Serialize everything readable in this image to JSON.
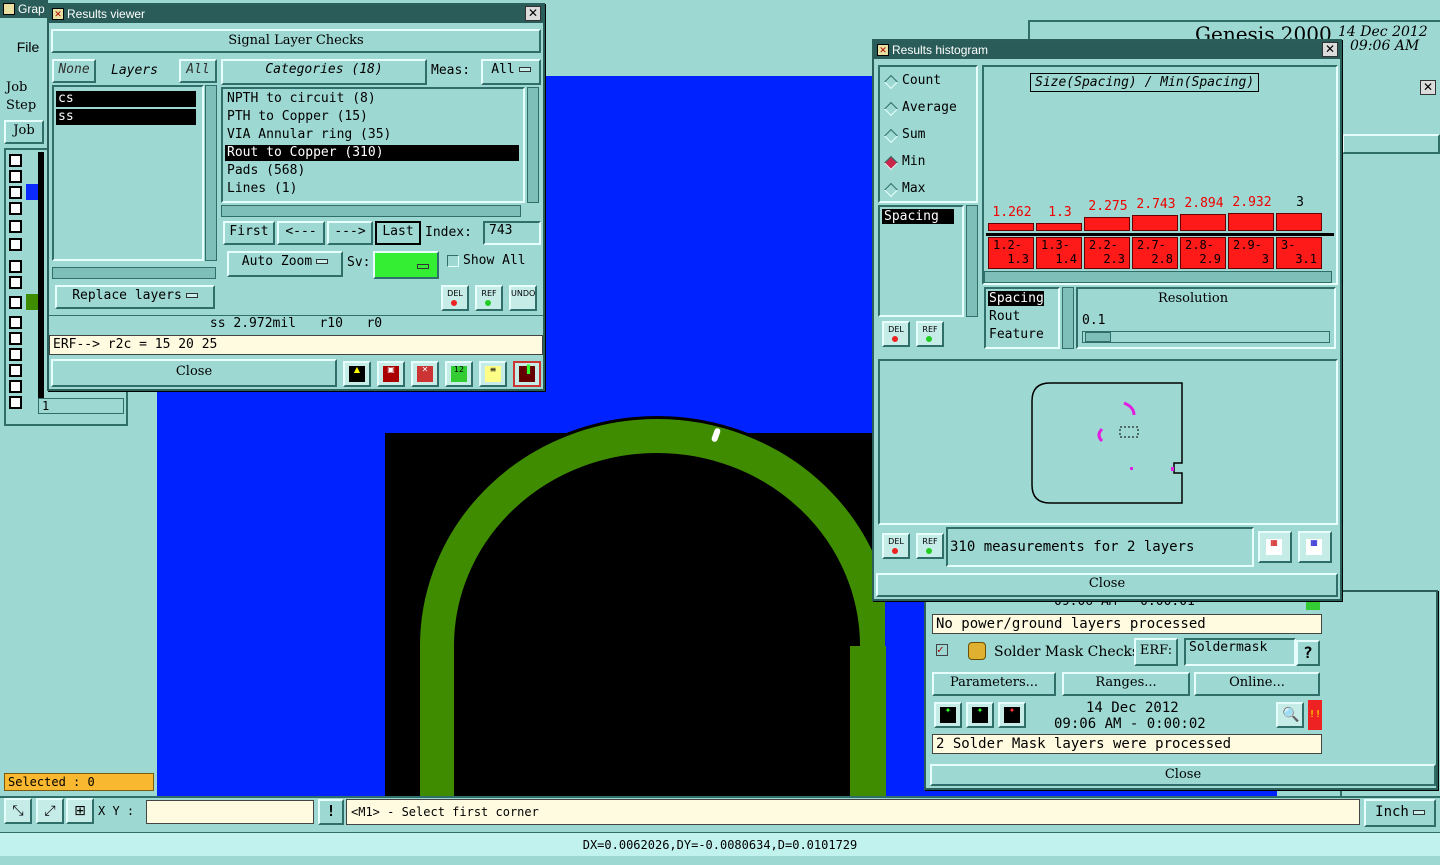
{
  "main": {
    "title": "Grap",
    "file_menu": "File",
    "genesis_title": "Genesis 2000",
    "date": "14 Dec 2012",
    "time": "09:06 AM",
    "job_label": "Job",
    "step_label": "Step",
    "job_button": "Job",
    "layer_last_index": "1",
    "selected": "Selected : 0",
    "xy_label": "X Y :",
    "xy_value": "",
    "status_message": "<M1> - Select first corner",
    "units": "Inch",
    "measure_readout": "DX=0.0062026,DY=-0.0080634,D=0.0101729",
    "colors": {
      "canvas_blue": "#0022ff",
      "trace_green": "#3f8c00",
      "panel": "#9ed8d2",
      "title_bar": "#2a5d59"
    }
  },
  "results_viewer": {
    "title": "Results viewer",
    "heading": "Signal Layer Checks",
    "none_button": "None",
    "layers_label": "Layers",
    "all_button": "All",
    "layers": [
      "cs",
      "ss"
    ],
    "categories_label": "Categories (18)",
    "meas_label": "Meas:",
    "meas_value": "All",
    "categories": [
      "NPTH to circuit (8)",
      "PTH to Copper (15)",
      "VIA Annular ring (35)",
      "Rout to Copper (310)",
      "Pads (568)",
      "Lines (1)"
    ],
    "selected_category": 3,
    "nav": {
      "first": "First",
      "prev": "<---",
      "next": "--->",
      "last": "Last"
    },
    "index_label": "Index:",
    "index_value": "743",
    "auto_zoom": "Auto Zoom",
    "sv_label": "Sv:",
    "show_all": "Show All",
    "replace_layers": "Replace layers",
    "del_label": "DEL",
    "ref_label": "REF",
    "undo_label": "UNDO",
    "info_line": "ss 2.972mil   r10   r0",
    "erf_line": "ERF--> r2c = 15 20 25",
    "close": "Close",
    "sv_color": "#33ee33"
  },
  "histogram": {
    "title": "Results histogram",
    "modes": [
      "Count",
      "Average",
      "Sum",
      "Min",
      "Max"
    ],
    "selected_mode": 3,
    "chart_title": "Size(Spacing) / Min(Spacing)",
    "attr_list": [
      "Spacing"
    ],
    "bars": [
      {
        "value": "1.262",
        "range": [
          "1.2-",
          "1.3"
        ],
        "level": 1.262
      },
      {
        "value": "1.3",
        "range": [
          "1.3-",
          "1.4"
        ],
        "level": 1.3
      },
      {
        "value": "2.275",
        "range": [
          "2.2-",
          "2.3"
        ],
        "level": 2.275
      },
      {
        "value": "2.743",
        "range": [
          "2.7-",
          "2.8"
        ],
        "level": 2.743
      },
      {
        "value": "2.894",
        "range": [
          "2.8-",
          "2.9"
        ],
        "level": 2.894
      },
      {
        "value": "2.932",
        "range": [
          "2.9-",
          "3"
        ],
        "level": 2.932
      },
      {
        "value": "3",
        "range": [
          "3-",
          "3.1"
        ],
        "level": 3
      }
    ],
    "size_list": [
      "Spacing",
      "Rout",
      "Feature"
    ],
    "resolution_label": "Resolution",
    "resolution_value": "0.1",
    "del_label": "DEL",
    "ref_label": "REF",
    "summary": "310 measurements for 2 layers",
    "close": "Close",
    "bar_color": "#ff1a1a"
  },
  "checklist": {
    "top_time": "09:06 AM - 0:00:01",
    "power_message": "No power/ground layers processed",
    "solder_title": "Solder Mask Checks",
    "erf_label": "ERF:",
    "erf_value": "Soldermask",
    "help": "?",
    "parameters": "Parameters...",
    "ranges": "Ranges...",
    "online": "Online...",
    "date": "14 Dec 2012",
    "time": "09:06 AM - 0:00:02",
    "solder_message": "2 Solder Mask layers were processed",
    "close": "Close"
  }
}
